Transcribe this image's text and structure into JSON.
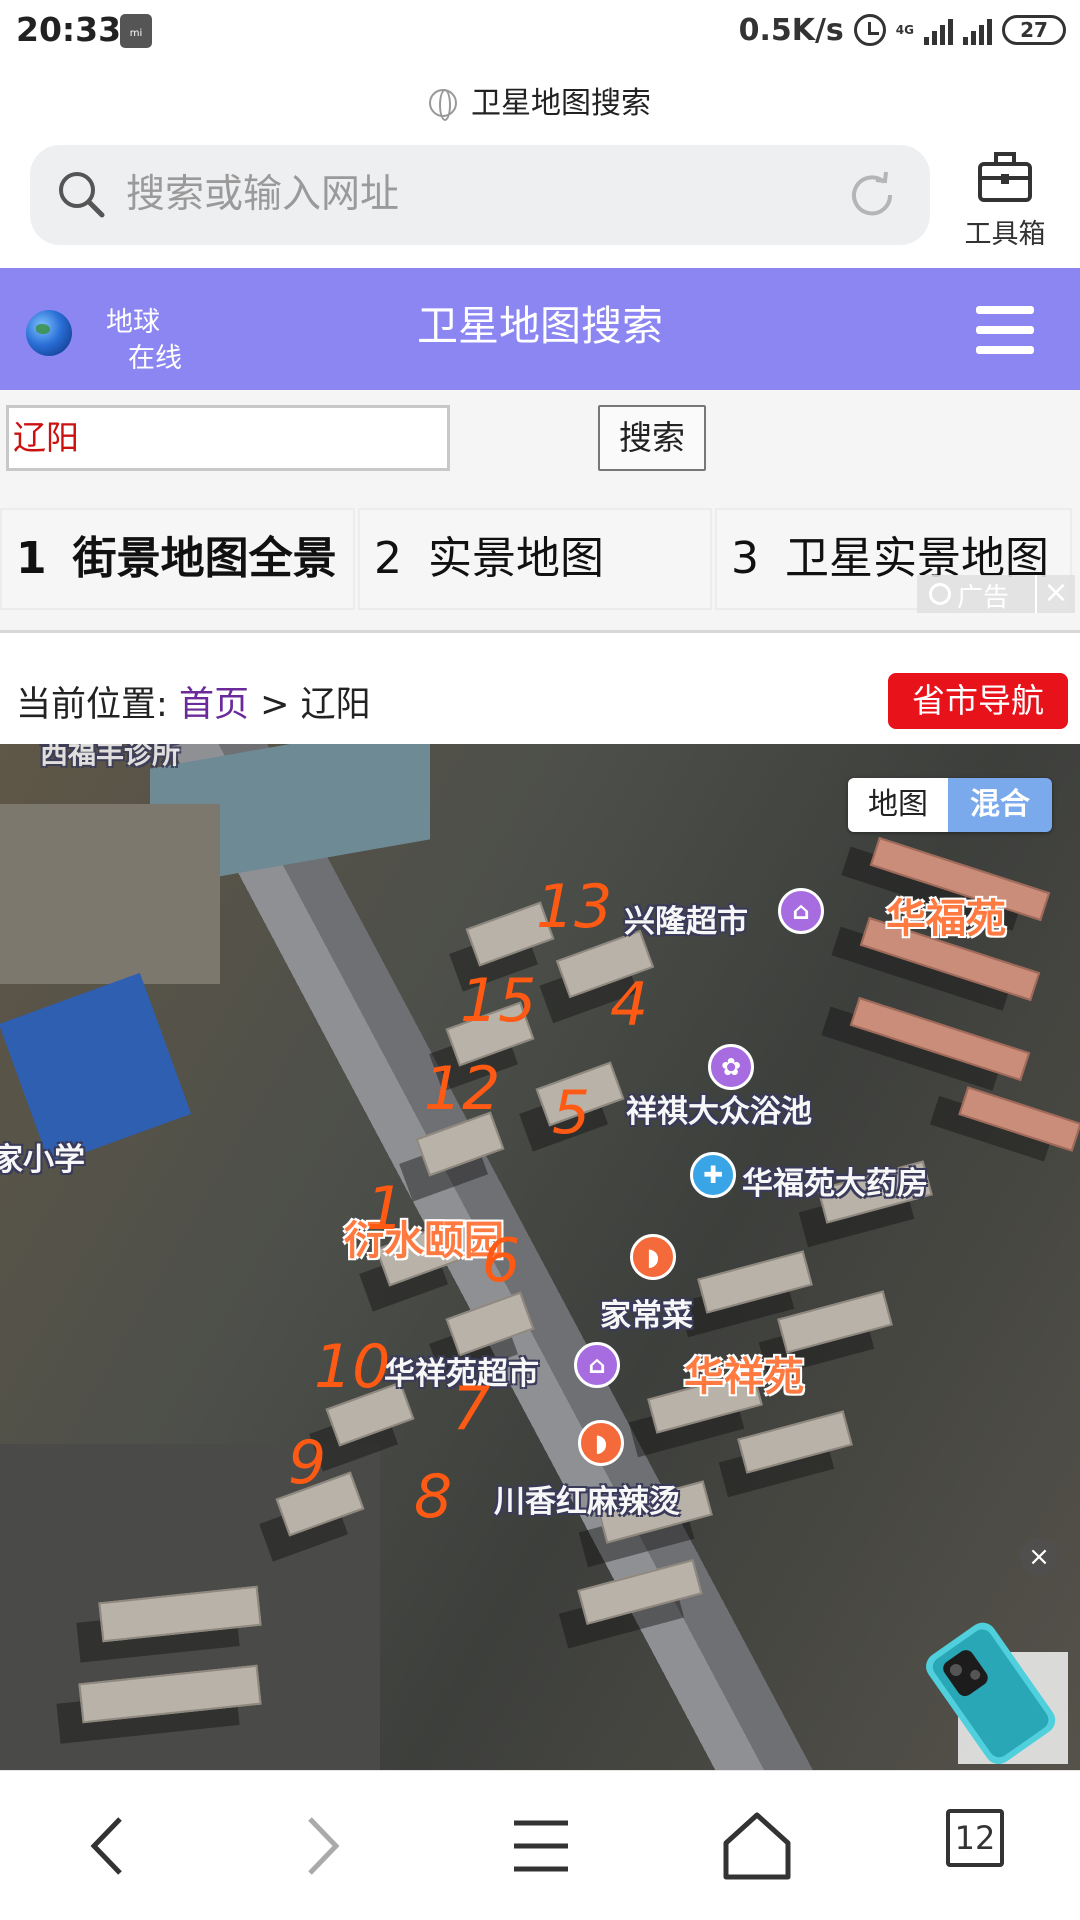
{
  "status_bar": {
    "time": "20:33",
    "network_speed": "0.5K/s",
    "network_type": "4G",
    "battery": "27"
  },
  "page_title": "卫星地图搜索",
  "browser": {
    "search_placeholder": "搜索或输入网址",
    "toolbox_label": "工具箱"
  },
  "site_header": {
    "logo_line1": "地球",
    "logo_line2": "在线",
    "title": "卫星地图搜索"
  },
  "search_form": {
    "input_value": "辽阳",
    "button_label": "搜索"
  },
  "tabs": [
    {
      "num": "1",
      "label": "街景地图全景"
    },
    {
      "num": "2",
      "label": "实景地图"
    },
    {
      "num": "3",
      "label": "卫星实景地图"
    }
  ],
  "ad_label": "广告",
  "breadcrumb": {
    "prefix": "当前位置:",
    "home": "首页",
    "separator": ">",
    "current": "辽阳"
  },
  "province_nav_label": "省市导航",
  "map": {
    "toggle_map": "地图",
    "toggle_mixed": "混合",
    "top_clip_label": "西福丰诊所",
    "labels": {
      "xinglong": "兴隆超市",
      "huafuyuan": "华福苑",
      "xiangqi": "祥祺大众浴池",
      "pharmacy": "华福苑大药房",
      "yishui": "衍水颐园",
      "jiachangcai": "家常菜",
      "huaxiang_market": "华祥苑超市",
      "huaxiangyuan": "华祥苑",
      "malatang": "川香红麻辣烫",
      "school": "家小学"
    },
    "handwritten": [
      "13",
      "15",
      "4",
      "12",
      "5",
      "1",
      "6",
      "10",
      "7",
      "9",
      "8"
    ]
  },
  "bottom_nav": {
    "tabs_count": "12"
  },
  "colors": {
    "header_bg": "#8b86f2",
    "nav_red": "#e8121a",
    "map_label_orange": "#ff7a40",
    "handwriting_orange": "#ff5a14"
  }
}
